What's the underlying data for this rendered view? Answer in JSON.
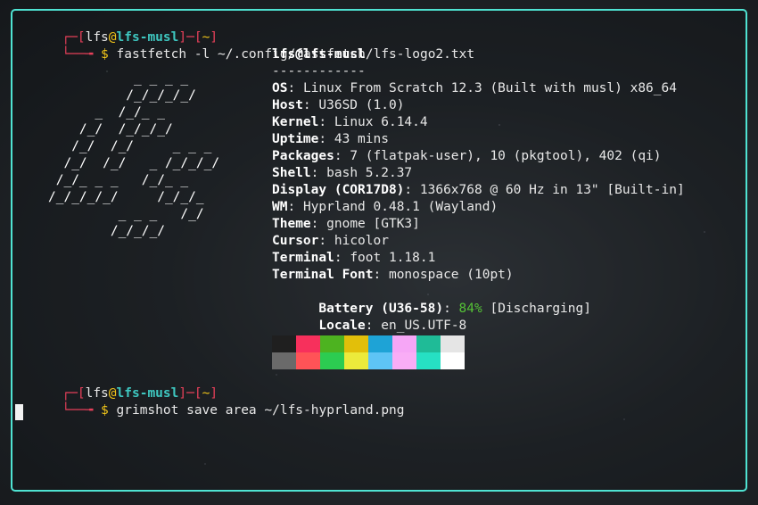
{
  "prompt1": {
    "open": "┌─[",
    "user": "lfs",
    "at": "@",
    "host": "lfs-musl",
    "mid": "]─[",
    "dir": "~",
    "close": "]",
    "tail": "└──╼",
    "dollar": "$",
    "command": "fastfetch -l ~/.config/fastfetch/lfs-logo2.txt"
  },
  "prompt2": {
    "open": "┌─[",
    "user": "lfs",
    "at": "@",
    "host": "lfs-musl",
    "mid": "]─[",
    "dir": "~",
    "close": "]",
    "tail": "└──╼",
    "dollar": "$",
    "command": "grimshot save area ~/lfs-hyprland.png"
  },
  "logo_lines": [
    "           _ _ _ _",
    "          /_/_/_/_/",
    "      _  /_/_ _",
    "    /_/  /_/_/_/",
    "   /_/  /_/     _ _ _",
    "  /_/  /_/   _ /_/_/_/",
    " /_/_ _ _   /_/_ _",
    "/_/_/_/_/     /_/_/_",
    "         _ _ _   /_/",
    "        /_/_/_/"
  ],
  "info": {
    "title": "lfs@lfs-musl",
    "separator": "------------",
    "rows": [
      {
        "key": "OS",
        "value": "Linux From Scratch 12.3 (Built with musl) x86_64"
      },
      {
        "key": "Host",
        "value": "U36SD (1.0)"
      },
      {
        "key": "Kernel",
        "value": "Linux 6.14.4"
      },
      {
        "key": "Uptime",
        "value": "43 mins"
      },
      {
        "key": "Packages",
        "value": "7 (flatpak-user), 10 (pkgtool), 402 (qi)"
      },
      {
        "key": "Shell",
        "value": "bash 5.2.37"
      },
      {
        "key": "Display (COR17D8)",
        "value": "1366x768 @ 60 Hz in 13\" [Built-in]"
      },
      {
        "key": "WM",
        "value": "Hyprland 0.48.1 (Wayland)"
      },
      {
        "key": "Theme",
        "value": "gnome [GTK3]"
      },
      {
        "key": "Cursor",
        "value": "hicolor"
      },
      {
        "key": "Terminal",
        "value": "foot 1.18.1"
      },
      {
        "key": "Terminal Font",
        "value": "monospace (10pt)"
      }
    ],
    "battery": {
      "key": "Battery (U36-58)",
      "percent": "84%",
      "status": "[Discharging]"
    },
    "locale": {
      "key": "Locale",
      "value": "en_US.UTF-8"
    }
  },
  "palette": {
    "normal": [
      "#1f1f1f",
      "#f7305c",
      "#4db320",
      "#e2bf0a",
      "#1ea3d6",
      "#f6a6f6",
      "#1fbb97",
      "#e5e5e5"
    ],
    "bright": [
      "#6a6a6a",
      "#ff5357",
      "#2ccc51",
      "#ecea3b",
      "#5ec4f5",
      "#f9adf6",
      "#26e0c3",
      "#ffffff"
    ]
  },
  "colors": {
    "border": "#4fe3d2",
    "accent_red": "#e8405a",
    "accent_yellow": "#f0c419",
    "accent_cyan": "#3ec7c0",
    "battery_green": "#55c236"
  }
}
